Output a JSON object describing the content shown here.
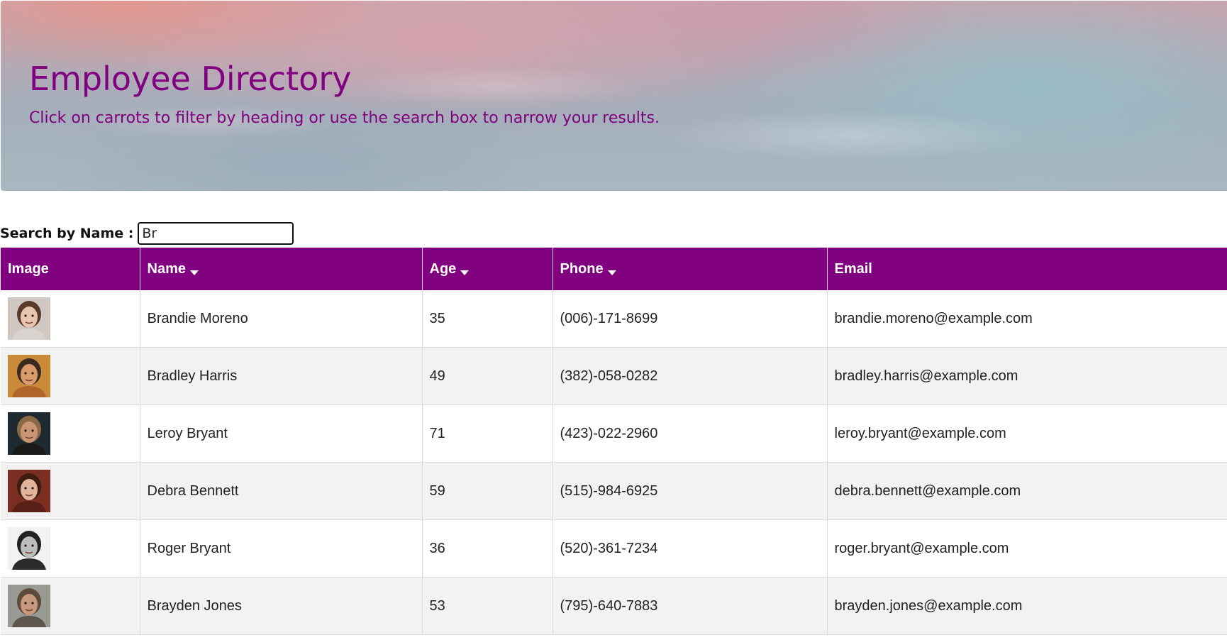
{
  "header": {
    "title": "Employee Directory",
    "subtitle": "Click on carrots to filter by heading or use the search box to narrow your results."
  },
  "search": {
    "label": "Search by Name :",
    "value": "Br"
  },
  "table": {
    "columns": [
      {
        "label": "Image",
        "sortable": false
      },
      {
        "label": "Name",
        "sortable": true
      },
      {
        "label": "Age",
        "sortable": true
      },
      {
        "label": "Phone",
        "sortable": true
      },
      {
        "label": "Email",
        "sortable": false
      }
    ],
    "rows": [
      {
        "name": "Brandie Moreno",
        "age": "35",
        "phone": "(006)-171-8699",
        "email": "brandie.moreno@example.com",
        "avatar": {
          "bg": "#cfc7c2",
          "hair": "#5a3a2a",
          "skin": "#e8c5b0",
          "shirt": "#d9d3cf"
        }
      },
      {
        "name": "Bradley Harris",
        "age": "49",
        "phone": "(382)-058-0282",
        "email": "bradley.harris@example.com",
        "avatar": {
          "bg": "#c98a3a",
          "hair": "#3b2a1e",
          "skin": "#d99a6c",
          "shirt": "#b0652a"
        }
      },
      {
        "name": "Leroy Bryant",
        "age": "71",
        "phone": "(423)-022-2960",
        "email": "leroy.bryant@example.com",
        "avatar": {
          "bg": "#1f2a30",
          "hair": "#8a6a45",
          "skin": "#c99574",
          "shirt": "#1a1a1a"
        }
      },
      {
        "name": "Debra Bennett",
        "age": "59",
        "phone": "(515)-984-6925",
        "email": "debra.bennett@example.com",
        "avatar": {
          "bg": "#7a2f22",
          "hair": "#3d1d12",
          "skin": "#e0b39a",
          "shirt": "#5a2018"
        }
      },
      {
        "name": "Roger Bryant",
        "age": "36",
        "phone": "(520)-361-7234",
        "email": "roger.bryant@example.com",
        "avatar": {
          "bg": "#f2f2f2",
          "hair": "#222222",
          "skin": "#bdbdbd",
          "shirt": "#2b2b2b"
        }
      },
      {
        "name": "Brayden Jones",
        "age": "53",
        "phone": "(795)-640-7883",
        "email": "brayden.jones@example.com",
        "avatar": {
          "bg": "#9a9a94",
          "hair": "#5c4a3a",
          "skin": "#c79a80",
          "shirt": "#5e564d"
        }
      }
    ]
  }
}
